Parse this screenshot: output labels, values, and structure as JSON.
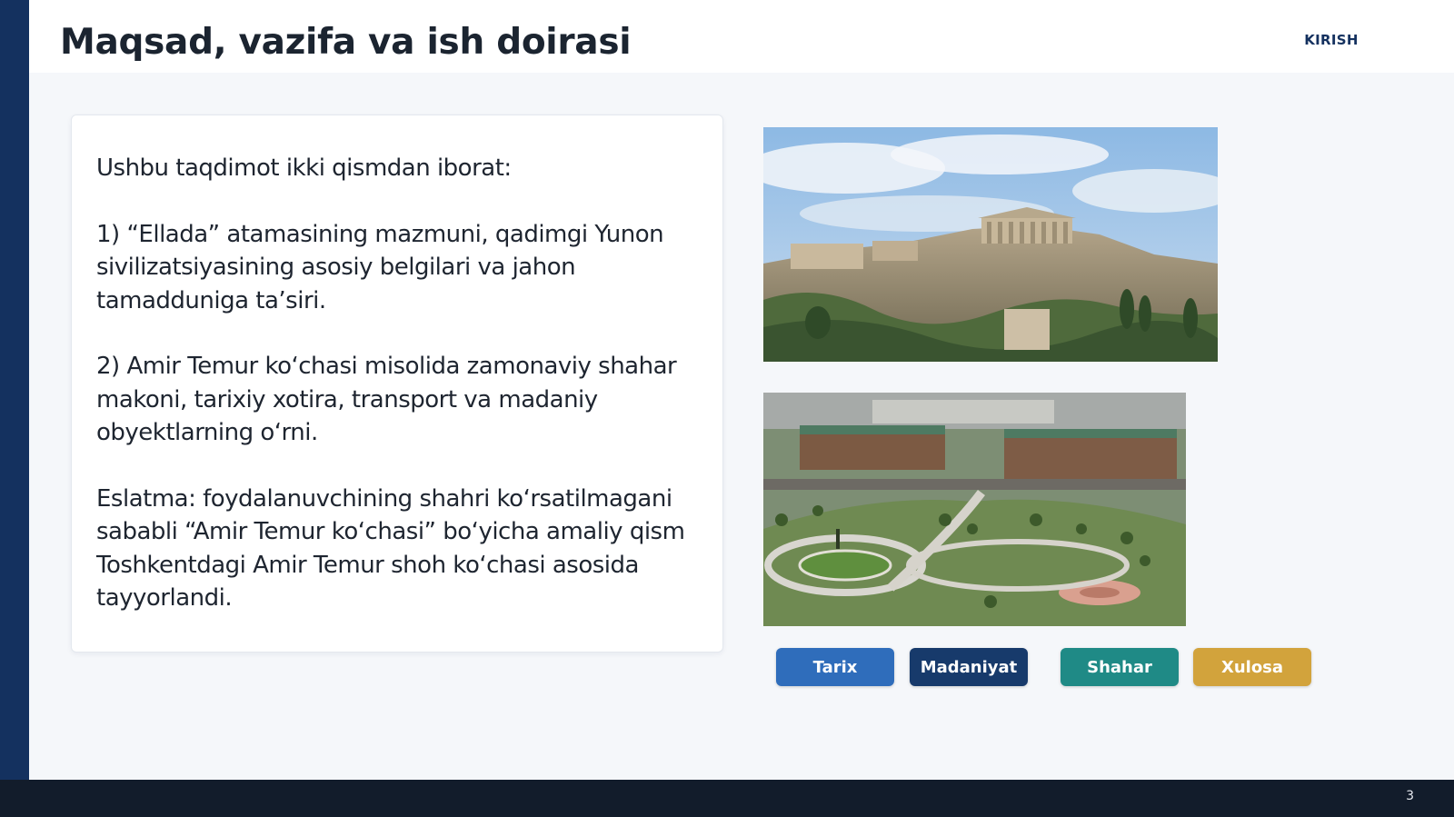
{
  "slide": {
    "title": "Maqsad, vazifa va ish doirasi",
    "section": "KIRISH",
    "page_number": "3"
  },
  "content": {
    "paragraphs": [
      "Ushbu taqdimot ikki qismdan iborat:",
      "1) “Ellada” atamasining mazmuni, qadimgi Yunon sivilizatsiyasining asosiy belgilari va jahon tamadduniga ta’siri.",
      "2) Amir Temur ko‘chasi misolida zamonaviy shahar makoni, tarixiy xotira, transport va madaniy obyektlarning o‘rni.",
      "Eslatma: foydalanuvchining shahri ko‘rsatilmagani sababli “Amir Temur ko‘chasi” bo‘yicha amaliy qism Toshkentdagi Amir Temur shoh ko‘chasi asosida tayyorlandi."
    ]
  },
  "tags": [
    {
      "label": "Tarix",
      "color": "#2f6dbb"
    },
    {
      "label": "Madaniyat",
      "color": "#173a6b"
    },
    {
      "label": "Shahar",
      "color": "#1f8a86"
    },
    {
      "label": "Xulosa",
      "color": "#d2a33c"
    }
  ],
  "colors": {
    "accent_dark": "#14315f",
    "footer": "#121c2b",
    "title_text": "#1b2430"
  }
}
